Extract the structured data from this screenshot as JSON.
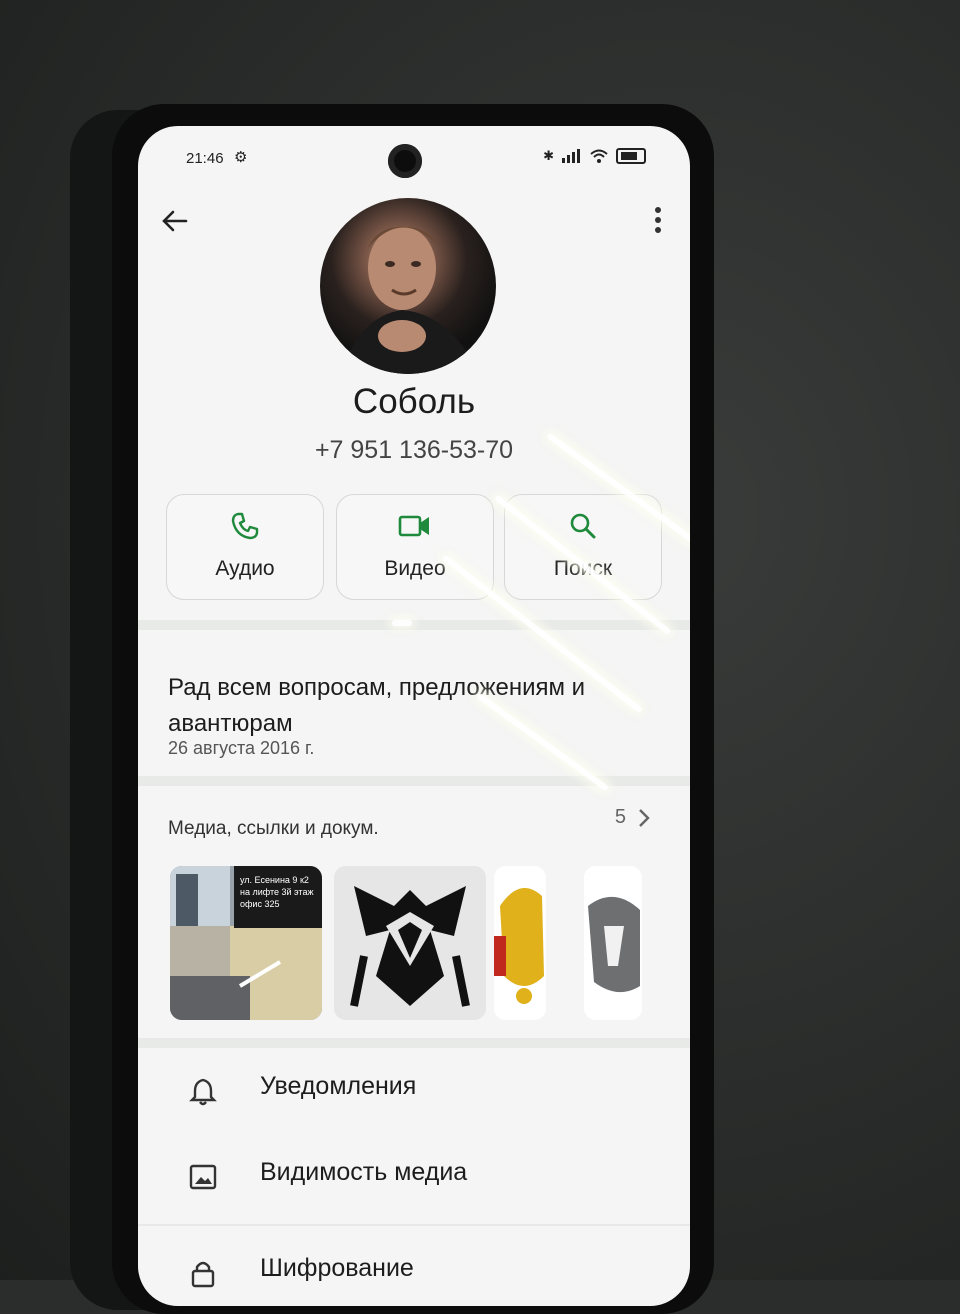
{
  "status": {
    "time": "21:46",
    "icons": [
      "settings-icon",
      "bluetooth-icon",
      "signal-icon",
      "wifi-icon",
      "battery-icon"
    ]
  },
  "header": {
    "back_icon": "arrow-left-icon",
    "menu_icon": "more-vert-icon"
  },
  "contact": {
    "name": "Соболь",
    "phone": "+7 951 136-53-70"
  },
  "actions": [
    {
      "label": "Аудио",
      "icon": "phone-icon"
    },
    {
      "label": "Видео",
      "icon": "video-icon"
    },
    {
      "label": "Поиск",
      "icon": "search-icon"
    }
  ],
  "about": {
    "text": "Рад всем вопросам, предложениям и авантюрам",
    "date": "26 августа 2016 г."
  },
  "media": {
    "title": "Медиа, ссылки и докум.",
    "count": "5",
    "thumb_text": [
      "ул. Есенина 9 к2",
      "на лифте 3й этаж",
      "офис 325"
    ]
  },
  "settings": [
    {
      "label": "Уведомления",
      "icon": "bell-icon"
    },
    {
      "label": "Видимость медиа",
      "icon": "image-icon"
    },
    {
      "label": "Шифрование",
      "icon": "lock-icon"
    }
  ],
  "colors": {
    "accent": "#1f8a3b",
    "background": "#f4f5f4",
    "text": "#1d1d1d"
  }
}
